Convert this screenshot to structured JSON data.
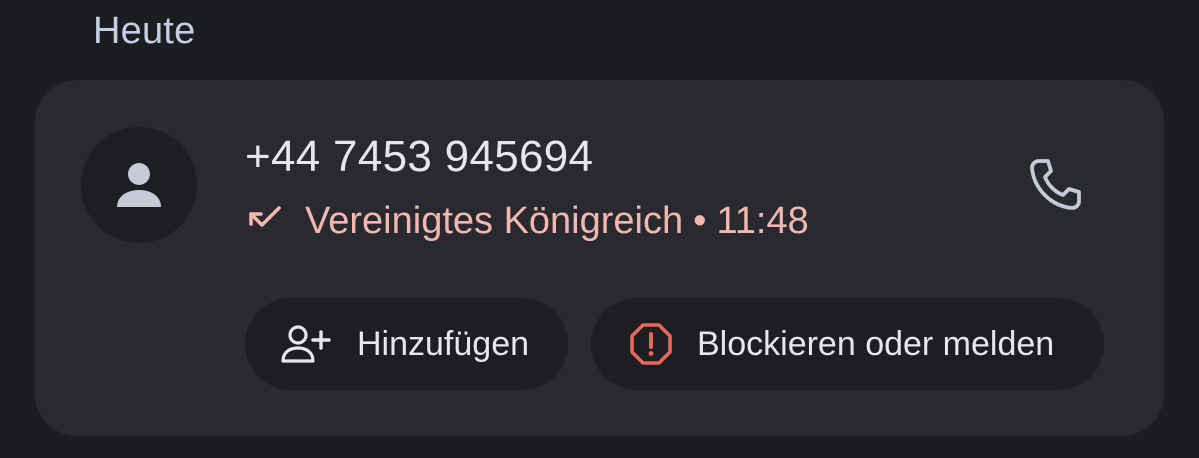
{
  "section": {
    "title": "Heute"
  },
  "call": {
    "number": "+44 7453 945694",
    "location": "Vereinigtes Königreich",
    "separator": "•",
    "time": "11:48",
    "status_color": "#f2b8b0"
  },
  "icons": {
    "avatar": "person-icon",
    "missed": "missed-call-icon",
    "call": "phone-icon",
    "add": "add-contact-icon",
    "block": "block-report-icon"
  },
  "actions": {
    "add_label": "Hinzufügen",
    "block_label": "Blockieren oder melden"
  },
  "colors": {
    "background": "#1c1d21",
    "card": "#282a2f",
    "chip": "#1d1e22",
    "block_icon": "#e8675c"
  }
}
